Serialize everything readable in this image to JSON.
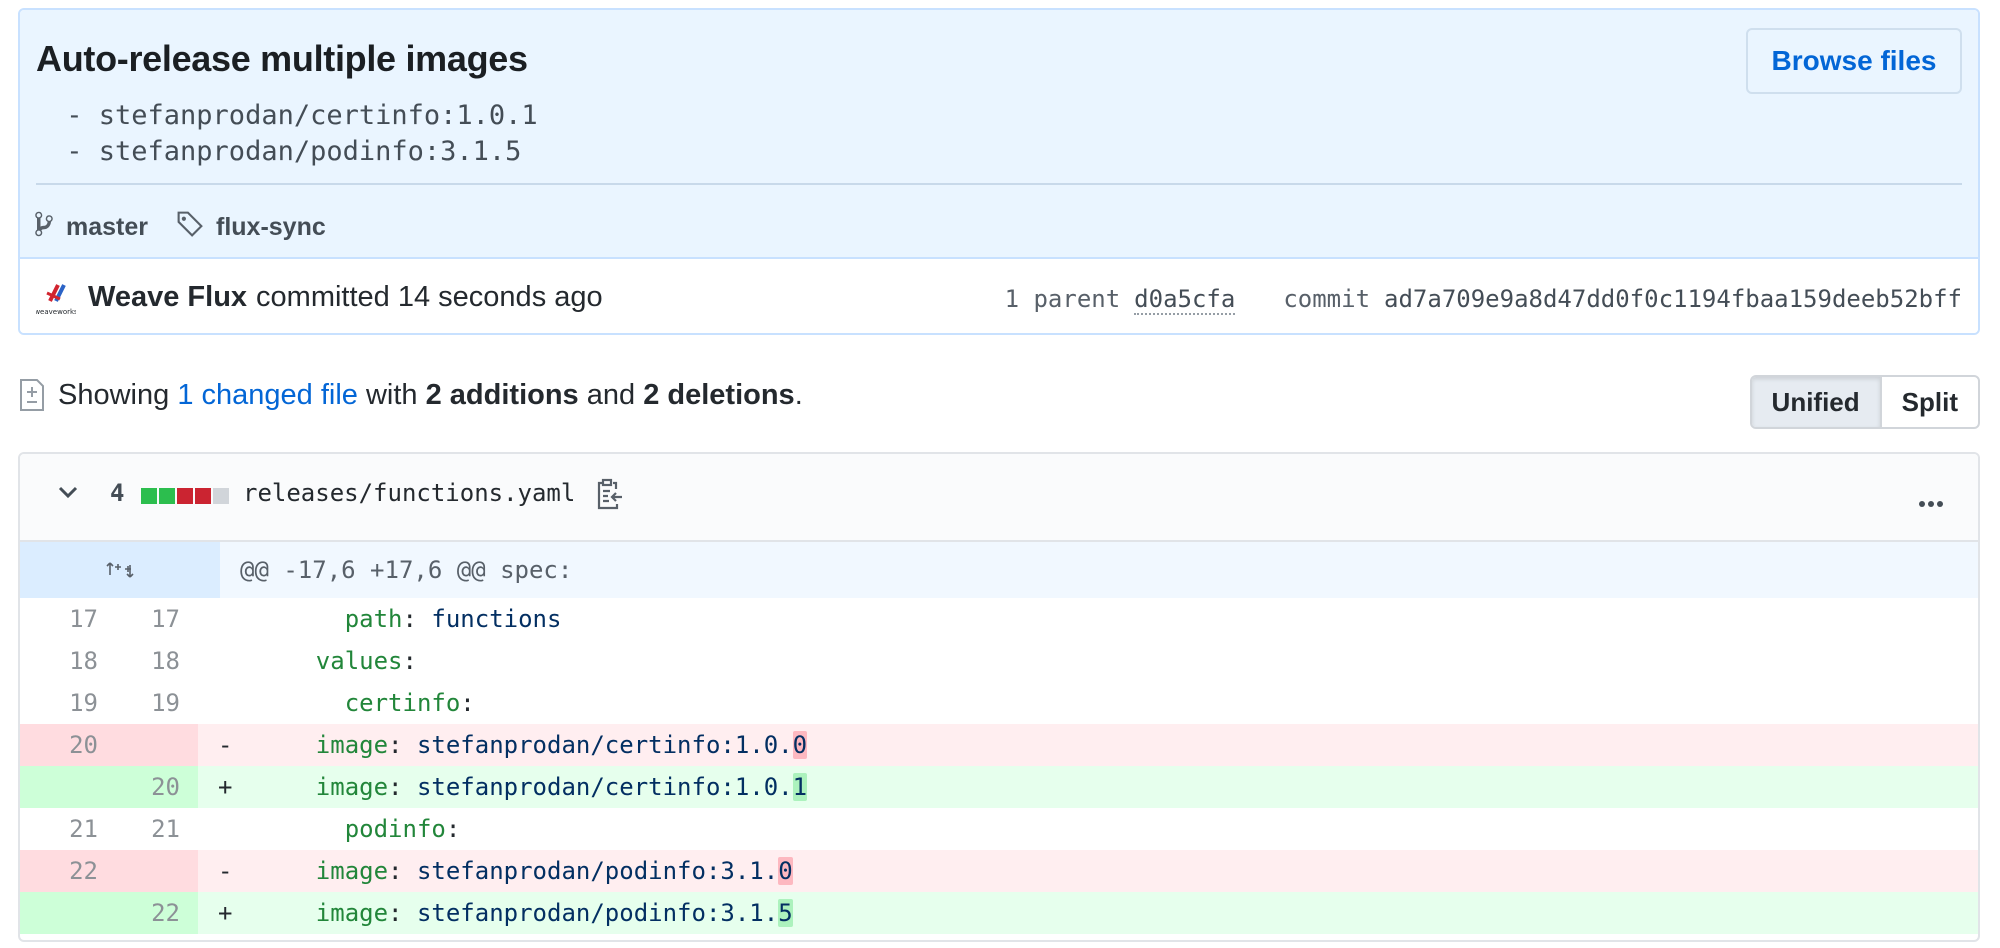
{
  "commit": {
    "title": "Auto-release multiple images",
    "description": [
      " - stefanprodan/certinfo:1.0.1",
      " - stefanprodan/podinfo:3.1.5"
    ],
    "browse_files_label": "Browse files",
    "branch": "master",
    "tag": "flux-sync",
    "author": "Weave Flux",
    "committed_text": "committed 14 seconds ago",
    "parent_label": "1 parent",
    "parent_sha": "d0a5cfa",
    "commit_label": "commit",
    "commit_sha": "ad7a709e9a8d47dd0f0c1194fbaa159deeb52bff"
  },
  "toc": {
    "showing": "Showing",
    "changed_files": "1 changed file",
    "with": "with",
    "additions": "2 additions",
    "and": "and",
    "deletions": "2 deletions",
    "period": "."
  },
  "diff_view": {
    "unified_label": "Unified",
    "split_label": "Split",
    "selected": "Unified"
  },
  "file": {
    "change_count": "4",
    "diffstat": [
      "added",
      "added",
      "deleted",
      "deleted",
      "neutral"
    ],
    "path": "releases/functions.yaml",
    "hunk_header": "@@ -17,6 +17,6 @@ spec:",
    "lines": [
      {
        "type": "ctx",
        "old": "17",
        "new": "17",
        "sign": "",
        "indent": "      ",
        "key": "path",
        "sep": ": ",
        "value": "functions",
        "changed": ""
      },
      {
        "type": "ctx",
        "old": "18",
        "new": "18",
        "sign": "",
        "indent": "    ",
        "key": "values",
        "sep": ":",
        "value": "",
        "changed": ""
      },
      {
        "type": "ctx",
        "old": "19",
        "new": "19",
        "sign": "",
        "indent": "      ",
        "key": "certinfo",
        "sep": ":",
        "value": "",
        "changed": ""
      },
      {
        "type": "del",
        "old": "20",
        "new": "",
        "sign": "-",
        "indent": "    ",
        "key": "image",
        "sep": ": ",
        "value": "stefanprodan/certinfo:1.0.",
        "changed": "0"
      },
      {
        "type": "add",
        "old": "",
        "new": "20",
        "sign": "+",
        "indent": "    ",
        "key": "image",
        "sep": ": ",
        "value": "stefanprodan/certinfo:1.0.",
        "changed": "1"
      },
      {
        "type": "ctx",
        "old": "21",
        "new": "21",
        "sign": "",
        "indent": "      ",
        "key": "podinfo",
        "sep": ":",
        "value": "",
        "changed": ""
      },
      {
        "type": "del",
        "old": "22",
        "new": "",
        "sign": "-",
        "indent": "    ",
        "key": "image",
        "sep": ": ",
        "value": "stefanprodan/podinfo:3.1.",
        "changed": "0"
      },
      {
        "type": "add",
        "old": "",
        "new": "22",
        "sign": "+",
        "indent": "    ",
        "key": "image",
        "sep": ": ",
        "value": "stefanprodan/podinfo:3.1.",
        "changed": "5"
      }
    ]
  },
  "colors": {
    "accent": "#0366d6",
    "commit_bg": "#eaf5ff",
    "added": "#2cbe4e",
    "deleted": "#cb2431",
    "neutral": "#d1d5da"
  },
  "icons": {
    "branch": "git-branch-icon",
    "tag": "tag-icon",
    "avatar": "weaveworks-logo",
    "file_diff": "file-diff-icon",
    "chevron": "chevron-down-icon",
    "clipboard": "clipboard-icon",
    "more": "kebab-horizontal-icon",
    "expand": "unfold-icon"
  }
}
